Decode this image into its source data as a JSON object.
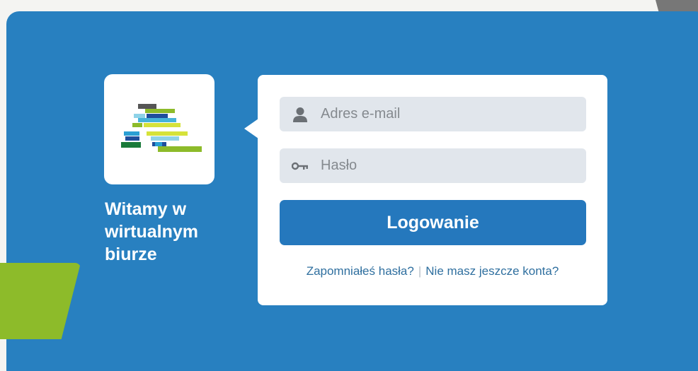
{
  "welcome": {
    "text": "Witamy w\nwirtualnym\nbiurze"
  },
  "form": {
    "email_placeholder": "Adres e-mail",
    "email_value": "",
    "password_placeholder": "Hasło",
    "password_value": "",
    "submit_label": "Logowanie",
    "forgot_password_link": "Zapomniałeś hasła?",
    "separator": "|",
    "register_link": "Nie masz jeszcze konta?"
  },
  "icons": {
    "email": "user-icon",
    "password": "key-icon"
  },
  "colors": {
    "panel": "#2880c0",
    "button": "#2578bd",
    "field": "#e1e6ec",
    "accent_green": "#8dbb2a",
    "link": "#2f6f9f"
  }
}
